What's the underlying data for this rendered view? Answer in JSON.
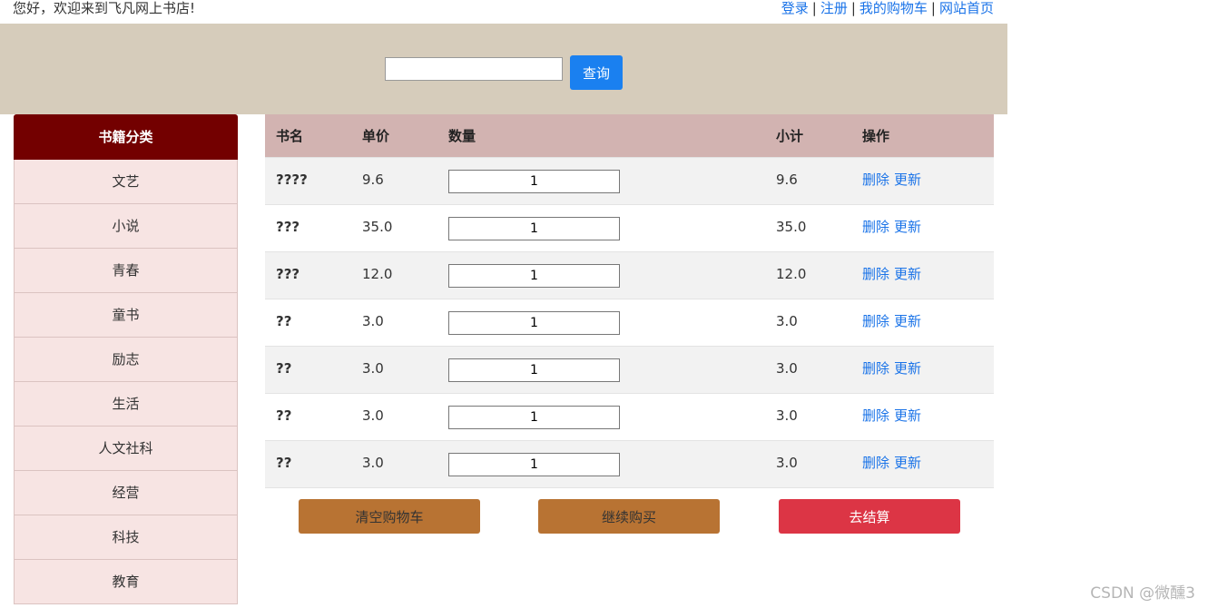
{
  "header": {
    "welcome": "您好，欢迎来到飞凡网上书店!",
    "links": {
      "login": "登录",
      "register": "注册",
      "cart": "我的购物车",
      "home": "网站首页"
    },
    "separator": "|"
  },
  "search": {
    "value": "",
    "button_label": "查询"
  },
  "sidebar": {
    "title": "书籍分类",
    "items": [
      "文艺",
      "小说",
      "青春",
      "童书",
      "励志",
      "生活",
      "人文社科",
      "经营",
      "科技",
      "教育"
    ]
  },
  "cart": {
    "columns": {
      "name": "书名",
      "price": "单价",
      "qty": "数量",
      "subtotal": "小计",
      "ops": "操作"
    },
    "rows": [
      {
        "name": "????",
        "price": "9.6",
        "qty": "1",
        "subtotal": "9.6"
      },
      {
        "name": "???",
        "price": "35.0",
        "qty": "1",
        "subtotal": "35.0"
      },
      {
        "name": "???",
        "price": "12.0",
        "qty": "1",
        "subtotal": "12.0"
      },
      {
        "name": "??",
        "price": "3.0",
        "qty": "1",
        "subtotal": "3.0"
      },
      {
        "name": "??",
        "price": "3.0",
        "qty": "1",
        "subtotal": "3.0"
      },
      {
        "name": "??",
        "price": "3.0",
        "qty": "1",
        "subtotal": "3.0"
      },
      {
        "name": "??",
        "price": "3.0",
        "qty": "1",
        "subtotal": "3.0"
      }
    ],
    "op_delete": "删除",
    "op_update": "更新"
  },
  "actions": {
    "clear": "清空购物车",
    "continue": "继续购买",
    "checkout": "去结算"
  },
  "watermark": "CSDN @微醺3",
  "colors": {
    "sidebar_head": "#730000",
    "sidebar_item": "#f7e4e3",
    "table_head": "#d2b3b1",
    "search_band": "#d6ccbb",
    "brown_button": "#b87333",
    "checkout_button": "#dc3545",
    "search_button": "#1a80f0",
    "link": "#1a73e8"
  }
}
